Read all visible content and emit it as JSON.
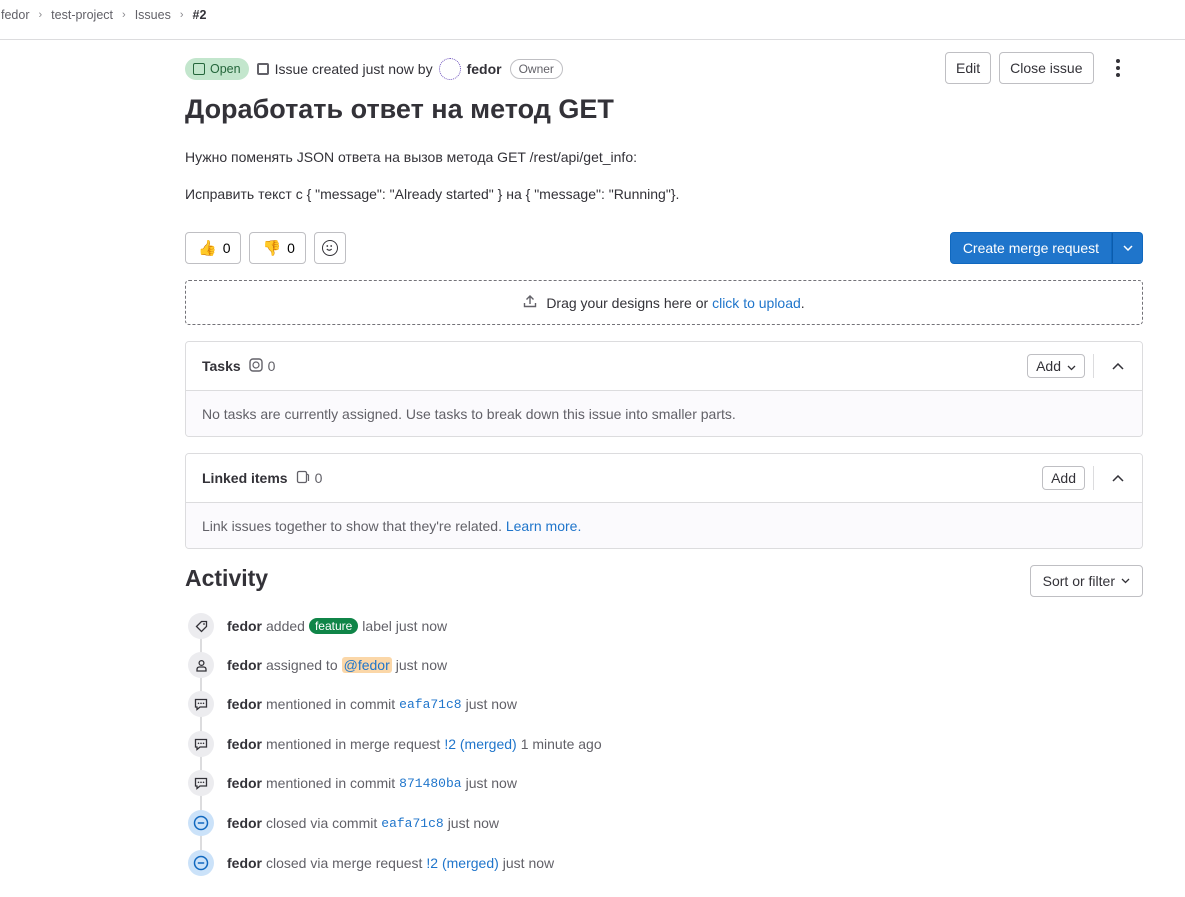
{
  "breadcrumb": {
    "items": [
      "fedor",
      "test-project",
      "Issues"
    ],
    "current": "#2"
  },
  "issue": {
    "status": "Open",
    "created_text": "Issue created just now by",
    "author": "fedor",
    "role_badge": "Owner",
    "title": "Доработать ответ на метод GET",
    "description_lines": [
      "Нужно поменять JSON ответа на вызов метода GET /rest/api/get_info:",
      "Исправить текст с { \"message\": \"Already started\" } на { \"message\": \"Running\"}."
    ]
  },
  "header_actions": {
    "edit": "Edit",
    "close": "Close issue"
  },
  "reactions": {
    "thumbs_up": "👍",
    "thumbs_up_count": "0",
    "thumbs_down": "👎",
    "thumbs_down_count": "0"
  },
  "merge_request": {
    "label": "Create merge request"
  },
  "upload": {
    "text": "Drag your designs here or",
    "link": "click to upload",
    "suffix": "."
  },
  "tasks": {
    "title": "Tasks",
    "count": "0",
    "add": "Add",
    "empty": "No tasks are currently assigned. Use tasks to break down this issue into smaller parts."
  },
  "linked": {
    "title": "Linked items",
    "count": "0",
    "add": "Add",
    "empty": "Link issues together to show that they're related.",
    "learn_more": "Learn more."
  },
  "activity": {
    "title": "Activity",
    "sort": "Sort or filter",
    "events": [
      {
        "user": "fedor",
        "pre": "added",
        "label": "feature",
        "post": "label just now"
      },
      {
        "user": "fedor",
        "pre": "assigned to",
        "mention": "@fedor",
        "post": "just now"
      },
      {
        "user": "fedor",
        "pre": "mentioned in commit",
        "ref": "eafa71c8",
        "post": "just now"
      },
      {
        "user": "fedor",
        "pre": "mentioned in merge request",
        "ref": "!2 (merged)",
        "post": "1 minute ago"
      },
      {
        "user": "fedor",
        "pre": "mentioned in commit",
        "ref": "871480ba",
        "post": "just now"
      },
      {
        "user": "fedor",
        "pre": "closed via commit",
        "ref": "eafa71c8",
        "post": "just now"
      },
      {
        "user": "fedor",
        "pre": "closed via merge request",
        "ref": "!2 (merged)",
        "post": "just now"
      }
    ]
  },
  "colors": {
    "accent": "#1f75cb",
    "open_badge_bg": "#c3e6cd",
    "label_feature": "#108548"
  }
}
